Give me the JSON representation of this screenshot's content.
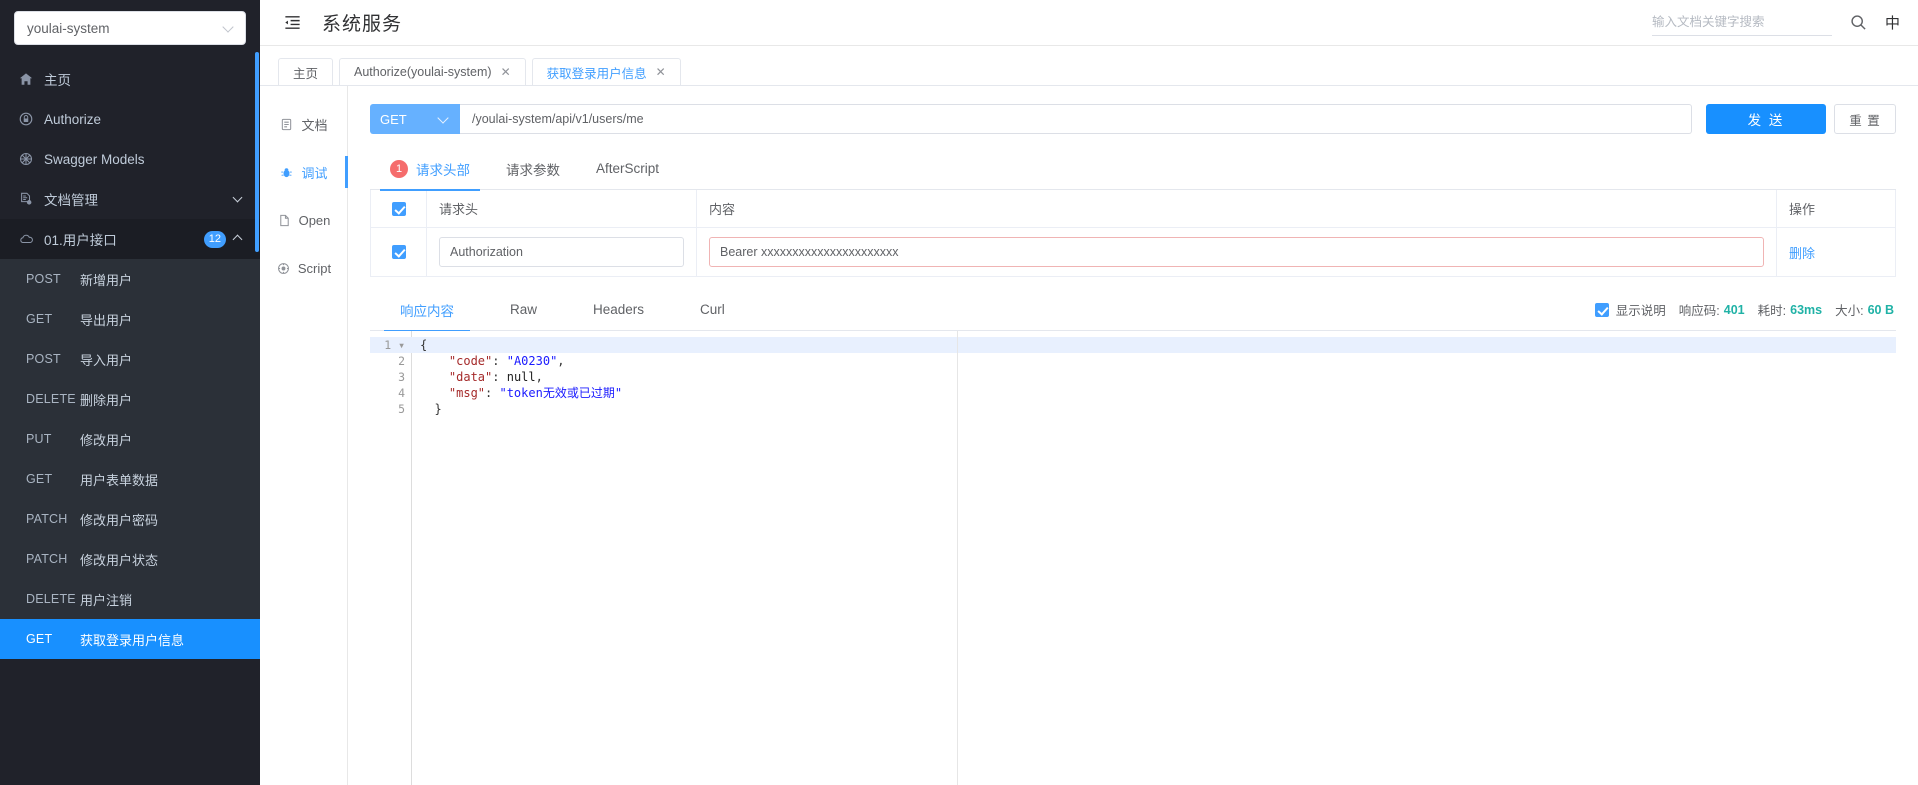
{
  "sidebar": {
    "project_select": {
      "value": "youlai-system",
      "icon": "chevron-down-icon"
    },
    "nav": [
      {
        "label": "主页",
        "icon": "home-icon"
      },
      {
        "label": "Authorize",
        "icon": "lock-icon"
      },
      {
        "label": "Swagger Models",
        "icon": "models-icon"
      },
      {
        "label": "文档管理",
        "icon": "doc-settings-icon",
        "expandable": true,
        "expanded": false
      },
      {
        "label": "01.用户接口",
        "icon": "cloud-icon",
        "badge": "12",
        "expandable": true,
        "expanded": true
      }
    ],
    "apis": [
      {
        "method": "POST",
        "name": "新增用户",
        "active": false
      },
      {
        "method": "GET",
        "name": "导出用户",
        "active": false
      },
      {
        "method": "POST",
        "name": "导入用户",
        "active": false
      },
      {
        "method": "DELETE",
        "name": "删除用户",
        "active": false
      },
      {
        "method": "PUT",
        "name": "修改用户",
        "active": false
      },
      {
        "method": "GET",
        "name": "用户表单数据",
        "active": false
      },
      {
        "method": "PATCH",
        "name": "修改用户密码",
        "active": false
      },
      {
        "method": "PATCH",
        "name": "修改用户状态",
        "active": false
      },
      {
        "method": "DELETE",
        "name": "用户注销",
        "active": false
      },
      {
        "method": "GET",
        "name": "获取登录用户信息",
        "active": true
      }
    ]
  },
  "topbar": {
    "collapse_icon": "menu-fold-icon",
    "title": "系统服务",
    "search_placeholder": "输入文档关键字搜索",
    "search_value": "",
    "search_icon": "search-icon",
    "lang_label": "中"
  },
  "tabs": [
    {
      "label": "主页",
      "closable": false,
      "active": false
    },
    {
      "label": "Authorize(youlai-system)",
      "closable": true,
      "active": false,
      "close": "✕"
    },
    {
      "label": "获取登录用户信息",
      "closable": true,
      "active": true,
      "close": "✕"
    }
  ],
  "subnav": [
    {
      "label": "文档",
      "icon": "document-icon",
      "active": false
    },
    {
      "label": "调试",
      "icon": "bug-icon",
      "active": true
    },
    {
      "label": "Open",
      "icon": "file-icon",
      "active": false
    },
    {
      "label": "Script",
      "icon": "script-icon",
      "active": false
    }
  ],
  "request": {
    "method": "GET",
    "method_chevron": "chevron-down-icon",
    "url": "/youlai-system/api/v1/users/me",
    "url_placeholder": "",
    "send_label": "发 送",
    "reset_label": "重 置",
    "tabs": [
      {
        "label": "请求头部",
        "badge": "1",
        "active": true
      },
      {
        "label": "请求参数",
        "badge": "",
        "active": false
      },
      {
        "label": "AfterScript",
        "badge": "",
        "active": false
      }
    ],
    "table": {
      "columns": [
        "请求头",
        "内容",
        "操作"
      ],
      "header_checked": true,
      "rows": [
        {
          "checked": true,
          "key": "Authorization",
          "value": "Bearer xxxxxxxxxxxxxxxxxxxxxx",
          "action": "删除"
        }
      ]
    }
  },
  "response": {
    "tabs": [
      {
        "label": "响应内容",
        "active": true
      },
      {
        "label": "Raw",
        "active": false
      },
      {
        "label": "Headers",
        "active": false
      },
      {
        "label": "Curl",
        "active": false
      }
    ],
    "show_desc_checked": true,
    "show_desc_label": "显示说明",
    "status_label": "响应码:",
    "status_value": "401",
    "time_label": "耗时:",
    "time_value": "63ms",
    "size_label": "大小:",
    "size_value": "60 B",
    "code": {
      "lines": [
        {
          "no": "1",
          "fold": true,
          "active": true,
          "tokens": [
            {
              "t": "{",
              "c": "p"
            }
          ]
        },
        {
          "no": "2",
          "fold": false,
          "active": false,
          "tokens": [
            {
              "t": "    ",
              "c": "p"
            },
            {
              "t": "\"code\"",
              "c": "k"
            },
            {
              "t": ": ",
              "c": "p"
            },
            {
              "t": "\"A0230\"",
              "c": "s"
            },
            {
              "t": ",",
              "c": "p"
            }
          ]
        },
        {
          "no": "3",
          "fold": false,
          "active": false,
          "tokens": [
            {
              "t": "    ",
              "c": "p"
            },
            {
              "t": "\"data\"",
              "c": "k"
            },
            {
              "t": ": ",
              "c": "p"
            },
            {
              "t": "null",
              "c": "n"
            },
            {
              "t": ",",
              "c": "p"
            }
          ]
        },
        {
          "no": "4",
          "fold": false,
          "active": false,
          "tokens": [
            {
              "t": "    ",
              "c": "p"
            },
            {
              "t": "\"msg\"",
              "c": "k"
            },
            {
              "t": ": ",
              "c": "p"
            },
            {
              "t": "\"token无效或已过期\"",
              "c": "s"
            }
          ]
        },
        {
          "no": "5",
          "fold": false,
          "active": false,
          "tokens": [
            {
              "t": "  ",
              "c": "p"
            },
            {
              "t": "}",
              "c": "p"
            }
          ]
        }
      ]
    }
  },
  "colors": {
    "accent": "#409eff",
    "primary_button": "#1890ff",
    "sidebar_bg": "#20222a",
    "submenu_bg": "#2b3038",
    "status_green": "#20b2a6",
    "badge_red": "#f56c6c"
  }
}
